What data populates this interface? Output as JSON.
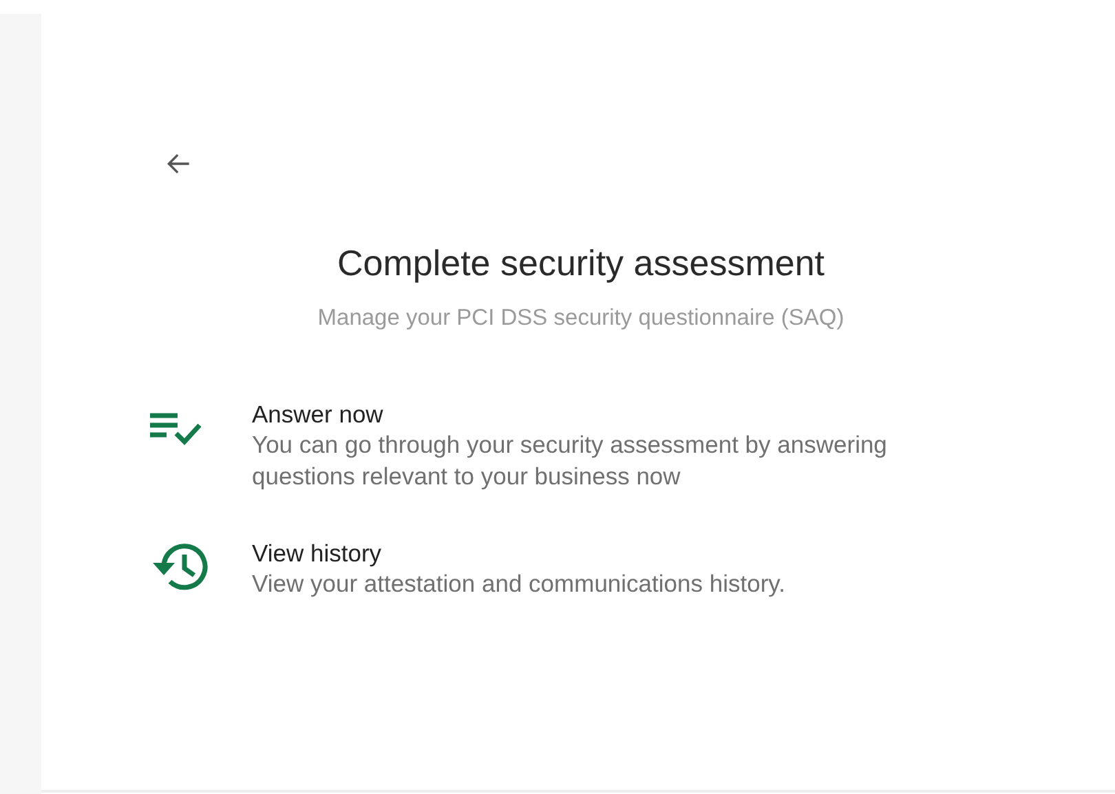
{
  "title": "Complete security assessment",
  "subtitle": "Manage your PCI DSS security questionnaire (SAQ)",
  "options": [
    {
      "kind": "checklist",
      "label": "Answer now",
      "description": "You can go through your security assessment by answering questions relevant to your business now"
    },
    {
      "kind": "history",
      "label": "View history",
      "description": "View your attestation and communications history."
    }
  ]
}
